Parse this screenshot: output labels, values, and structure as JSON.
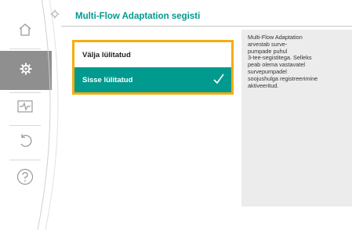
{
  "header": {
    "title": "Multi-Flow Adaptation segisti",
    "icon": "gear-icon"
  },
  "sidebar": {
    "items": [
      {
        "name": "home",
        "icon": "home-icon",
        "active": false
      },
      {
        "name": "settings",
        "icon": "gear-icon",
        "active": true
      },
      {
        "name": "diagnostics",
        "icon": "waveform-icon",
        "active": false
      },
      {
        "name": "back",
        "icon": "back-arrow-icon",
        "active": false
      },
      {
        "name": "help",
        "icon": "question-icon",
        "active": false
      }
    ]
  },
  "options": [
    {
      "label": "Välja lülitatud",
      "selected": false
    },
    {
      "label": "Sisse lülitatud",
      "selected": true
    }
  ],
  "help": {
    "text": "Multi-Flow Adaptation\narvestab surve-\npumpade puhul\n3-tee-segistitega. Selleks\npeab olema vastavatel\nsurvepumpadel\nsoojushulga registreerimine\naktiveeritud."
  },
  "colors": {
    "accent": "#009a8f",
    "focus": "#f5ad0f",
    "sidebar_active": "#8f8f8f",
    "help_bg": "#ececec"
  }
}
